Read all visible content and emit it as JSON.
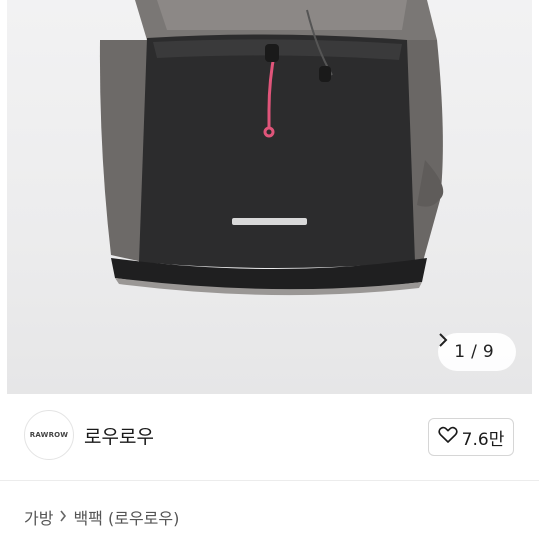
{
  "gallery": {
    "current": "1",
    "separator": "/",
    "total": "9",
    "next_icon": "chevron-right-icon",
    "product_image": "black-gray-drawstring-backpack"
  },
  "seller": {
    "logo_text": "RAWROW",
    "name": "로우로우",
    "likes": "7.6만",
    "like_icon": "heart-outline-icon"
  },
  "breadcrumb": {
    "items": [
      "가방",
      "백팩 (로우로우)"
    ],
    "separator_icon": "chevron-right-icon"
  },
  "colors": {
    "accent_cord": "#e0557a",
    "bag_dark": "#2b2b2b",
    "bag_gray": "#6f6c6a"
  }
}
